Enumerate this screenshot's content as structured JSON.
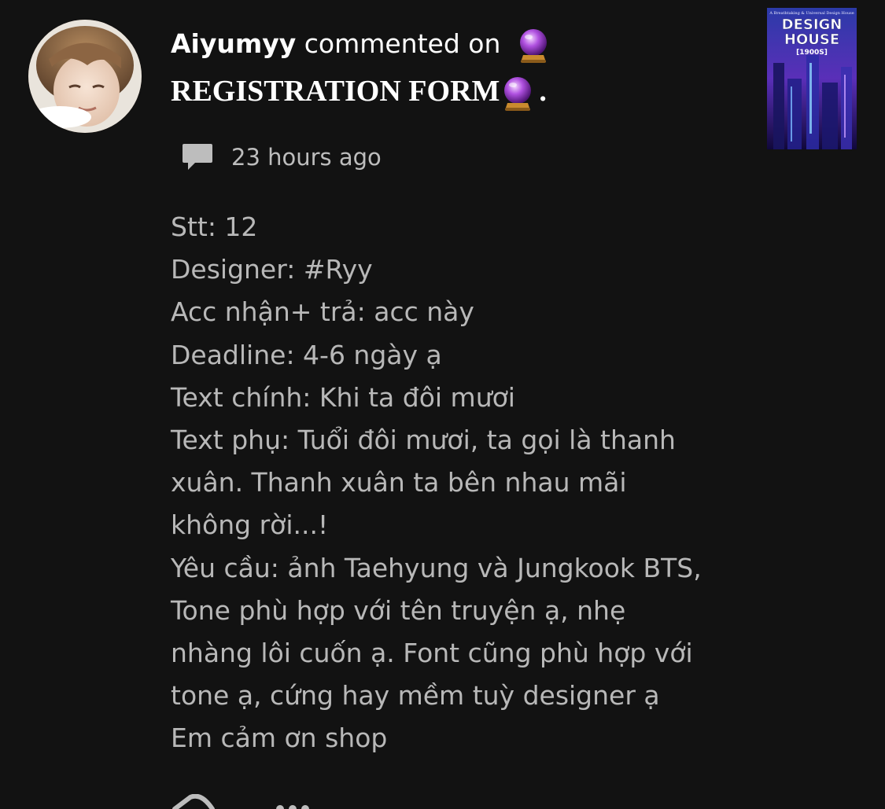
{
  "notification": {
    "username": "Aiyumyy",
    "action_text": " commented on ",
    "story_title": "REGISTRATION FORM",
    "title_suffix": ".",
    "timestamp": "23 hours ago"
  },
  "icons": {
    "avatar": "user-avatar",
    "title_emoji": "crystal-ball-icon",
    "comment": "comment-bubble-icon",
    "reply": "reply-arrow-icon",
    "more": "more-dots-icon"
  },
  "cover": {
    "tagline": "A Breathtaking & Universal Design House",
    "title_line1": "DESIGN",
    "title_line2": "HOUSE",
    "subtitle": "[1900S]"
  },
  "comment": {
    "lines": [
      "Stt: 12",
      "Designer: #Ryy",
      "Acc nhận+ trả: acc này",
      "Deadline: 4-6 ngày ạ",
      "Text chính: Khi ta đôi mươi",
      "Text phụ: Tuổi đôi mươi, ta gọi là thanh",
      "xuân. Thanh xuân ta bên nhau mãi",
      "không rời...!",
      "Yêu cầu: ảnh Taehyung và Jungkook BTS,",
      "Tone phù hợp với tên truyện ạ, nhẹ",
      "nhàng lôi cuốn ạ. Font cũng phù hợp với",
      "tone ạ, cứng hay mềm tuỳ designer ạ",
      "Em cảm ơn shop"
    ]
  },
  "colors": {
    "background": "#121212",
    "primary_text": "#ffffff",
    "secondary_text": "#b8b8b8",
    "meta_text": "#bdbdbd"
  }
}
